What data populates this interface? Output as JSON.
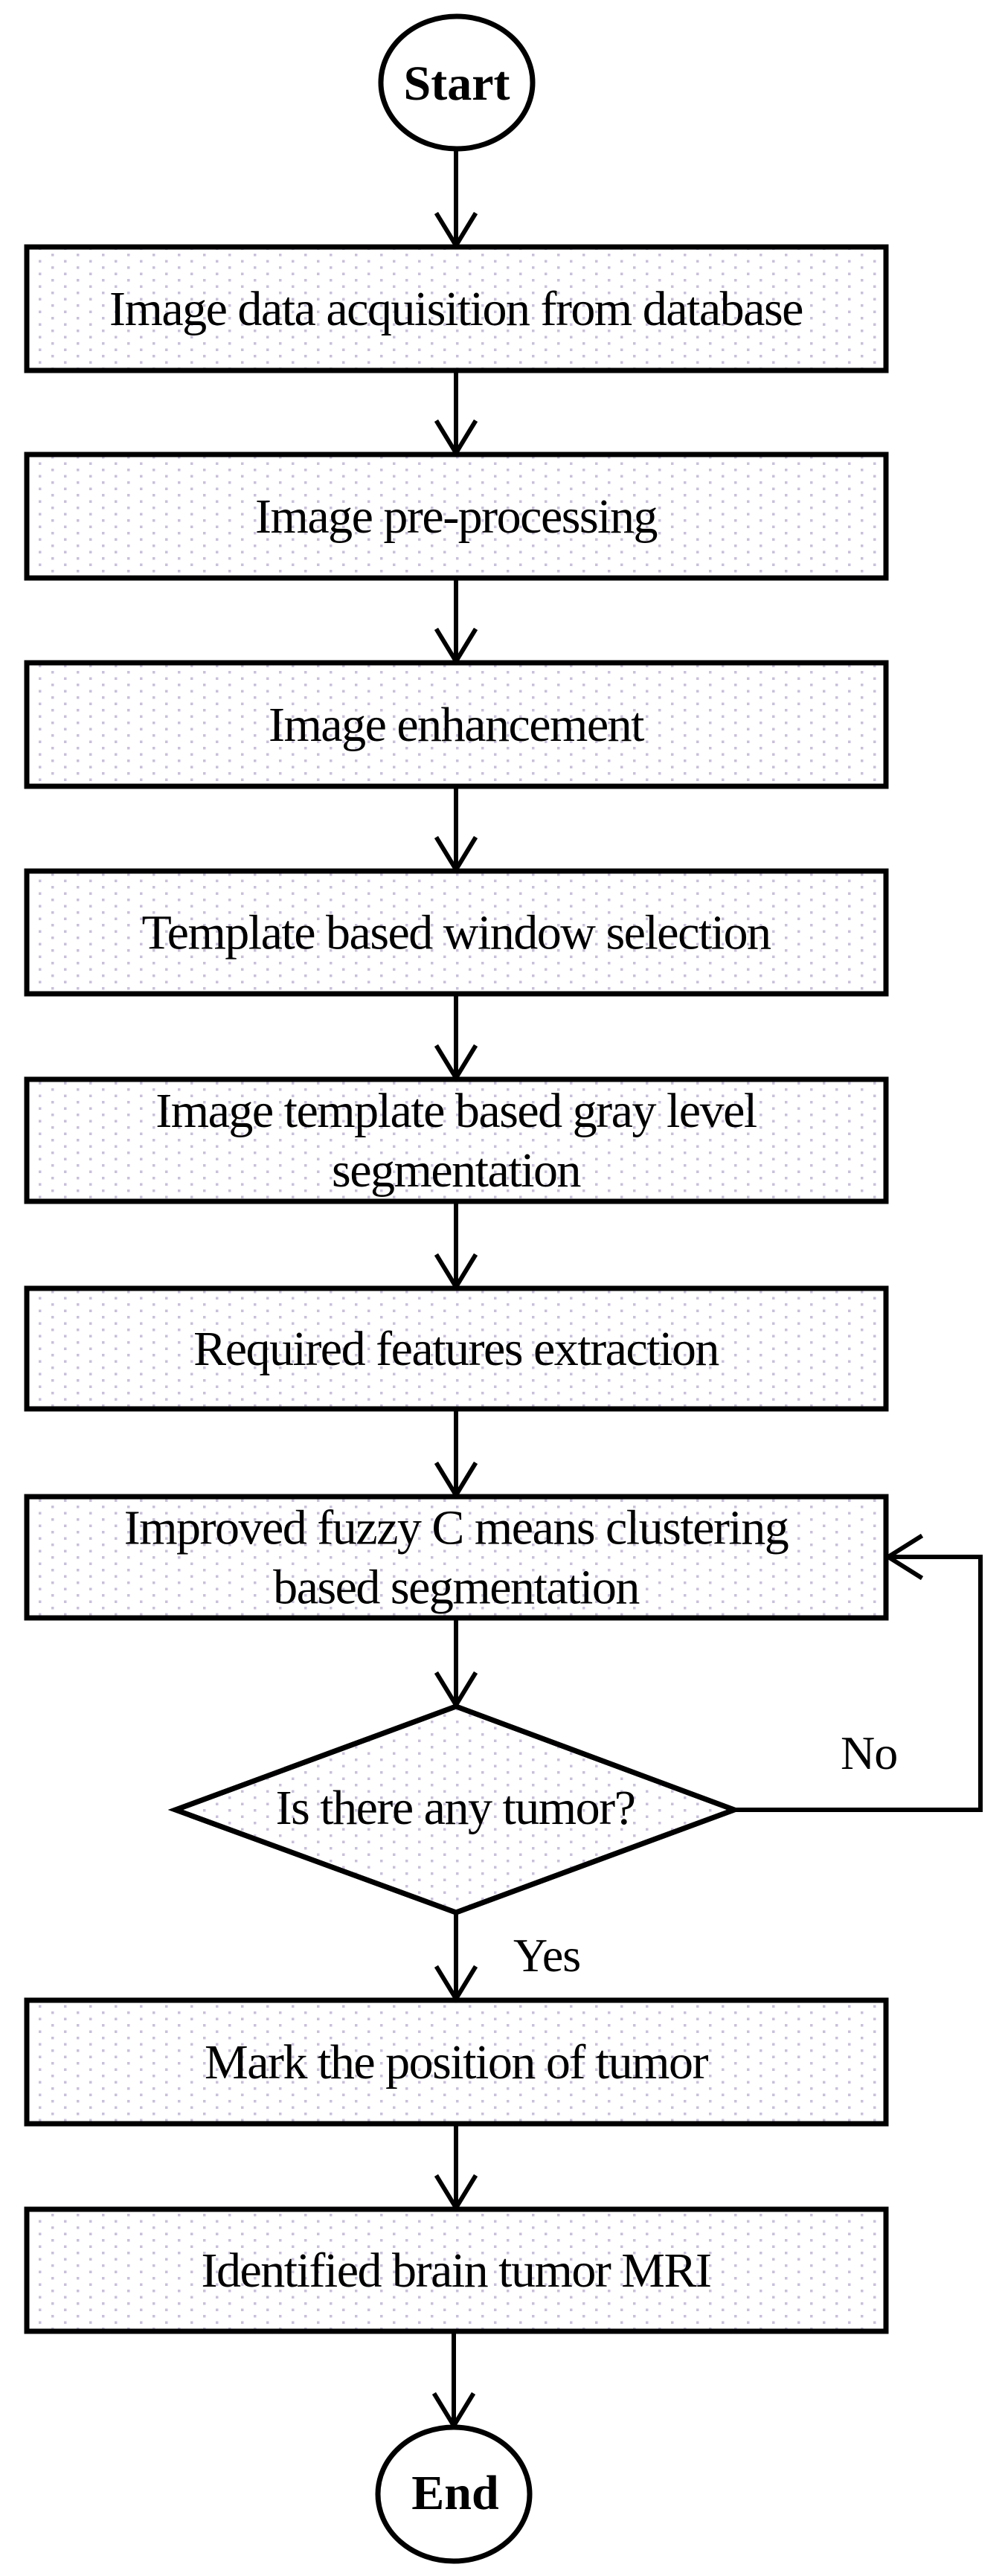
{
  "diagram": {
    "type": "flowchart",
    "start_label": "Start",
    "end_label": "End",
    "steps": [
      {
        "id": "step-1",
        "lines": [
          "Image data acquisition from database"
        ]
      },
      {
        "id": "step-2",
        "lines": [
          "Image pre-processing"
        ]
      },
      {
        "id": "step-3",
        "lines": [
          "Image enhancement"
        ]
      },
      {
        "id": "step-4",
        "lines": [
          "Template based window selection"
        ]
      },
      {
        "id": "step-5",
        "lines": [
          "Image template based gray level",
          "segmentation"
        ]
      },
      {
        "id": "step-6",
        "lines": [
          "Required features extraction"
        ]
      },
      {
        "id": "step-7",
        "lines": [
          "Improved fuzzy C means clustering",
          "based segmentation"
        ]
      }
    ],
    "decision": {
      "id": "decision-tumor",
      "label": "Is there any tumor?",
      "yes_label": "Yes",
      "no_label": "No"
    },
    "after_steps": [
      {
        "id": "step-8",
        "lines": [
          "Mark the position of tumor"
        ]
      },
      {
        "id": "step-9",
        "lines": [
          "Identified brain tumor MRI"
        ]
      }
    ],
    "edges": [
      {
        "from": "start",
        "to": "step-1"
      },
      {
        "from": "step-1",
        "to": "step-2"
      },
      {
        "from": "step-2",
        "to": "step-3"
      },
      {
        "from": "step-3",
        "to": "step-4"
      },
      {
        "from": "step-4",
        "to": "step-5"
      },
      {
        "from": "step-5",
        "to": "step-6"
      },
      {
        "from": "step-6",
        "to": "step-7"
      },
      {
        "from": "step-7",
        "to": "decision-tumor"
      },
      {
        "from": "decision-tumor",
        "to": "step-8",
        "label": "Yes"
      },
      {
        "from": "decision-tumor",
        "to": "step-7",
        "label": "No"
      },
      {
        "from": "step-8",
        "to": "step-9"
      },
      {
        "from": "step-9",
        "to": "end"
      }
    ],
    "colors": {
      "stroke": "#000000",
      "fill_dot": "#c9c0db",
      "background": "#ffffff"
    }
  }
}
